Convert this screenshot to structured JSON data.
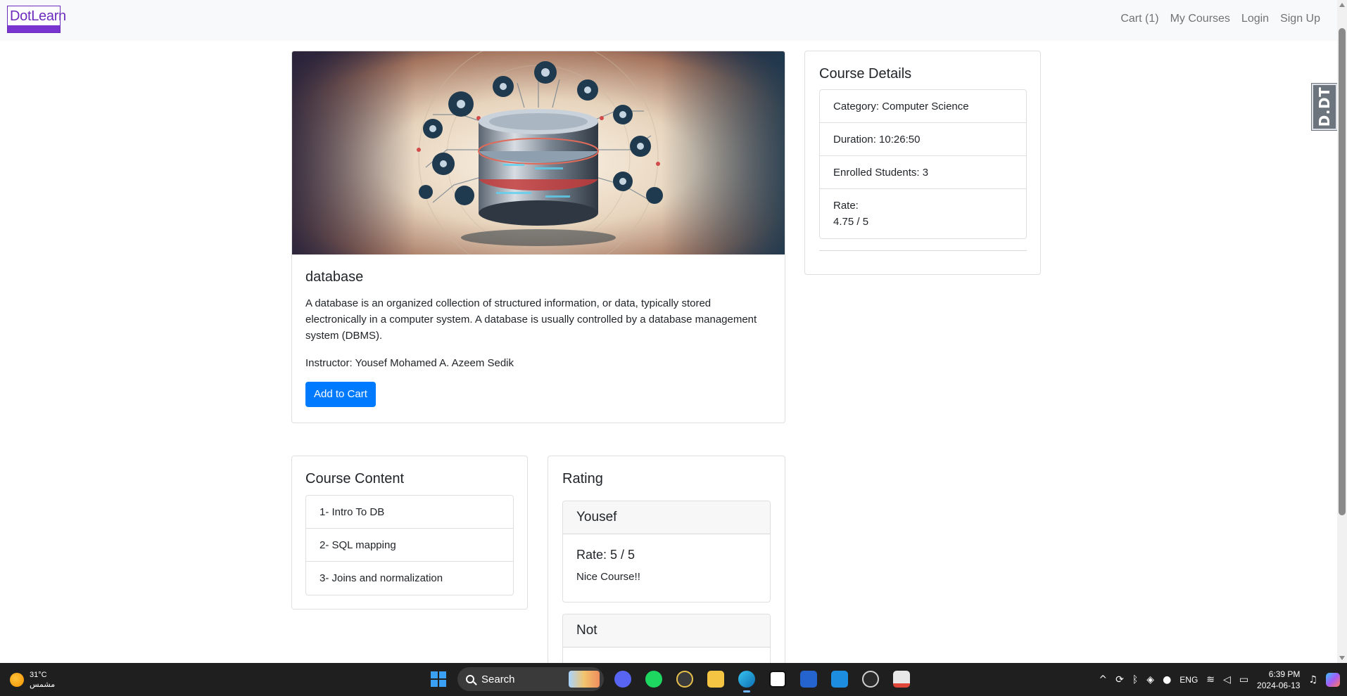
{
  "navbar": {
    "brand": "DotLearn",
    "links": [
      "Cart (1)",
      "My Courses",
      "Login",
      "Sign Up"
    ]
  },
  "course": {
    "title": "database",
    "description": "A database is an organized collection of structured information, or data, typically stored electronically in a computer system. A database is usually controlled by a database management system (DBMS).",
    "instructor": "Instructor: Yousef Mohamed A. Azeem Sedik",
    "add_to_cart": "Add to Cart"
  },
  "details": {
    "title": "Course Details",
    "category": "Category: Computer Science",
    "duration": "Duration: 10:26:50",
    "enrolled": "Enrolled Students: 3",
    "rate_label": "Rate:",
    "rate_value": "4.75 / 5"
  },
  "content": {
    "title": "Course Content",
    "items": [
      "1- Intro To DB",
      "2- SQL mapping",
      "3- Joins and normalization"
    ]
  },
  "rating": {
    "title": "Rating",
    "reviews": [
      {
        "name": "Yousef",
        "rate": "Rate: 5 / 5",
        "comment": "Nice Course!!"
      },
      {
        "name": "Not"
      }
    ]
  },
  "side_badge": "D.DT",
  "taskbar": {
    "temperature": "31°C",
    "weather": "مشمس",
    "search": "Search",
    "language": "ENG",
    "time": "6:39 PM",
    "date": "2024-06-13",
    "apps": [
      "start-icon",
      "discord-icon",
      "spotify-icon",
      "chrome-dev-icon",
      "file-explorer-icon",
      "edge-icon",
      "notion-icon",
      "todo-icon",
      "vscode-icon",
      "obs-icon",
      "snipping-tool-icon"
    ]
  },
  "colors": {
    "primary": "#007bff",
    "brand": "#6b2bbd"
  }
}
